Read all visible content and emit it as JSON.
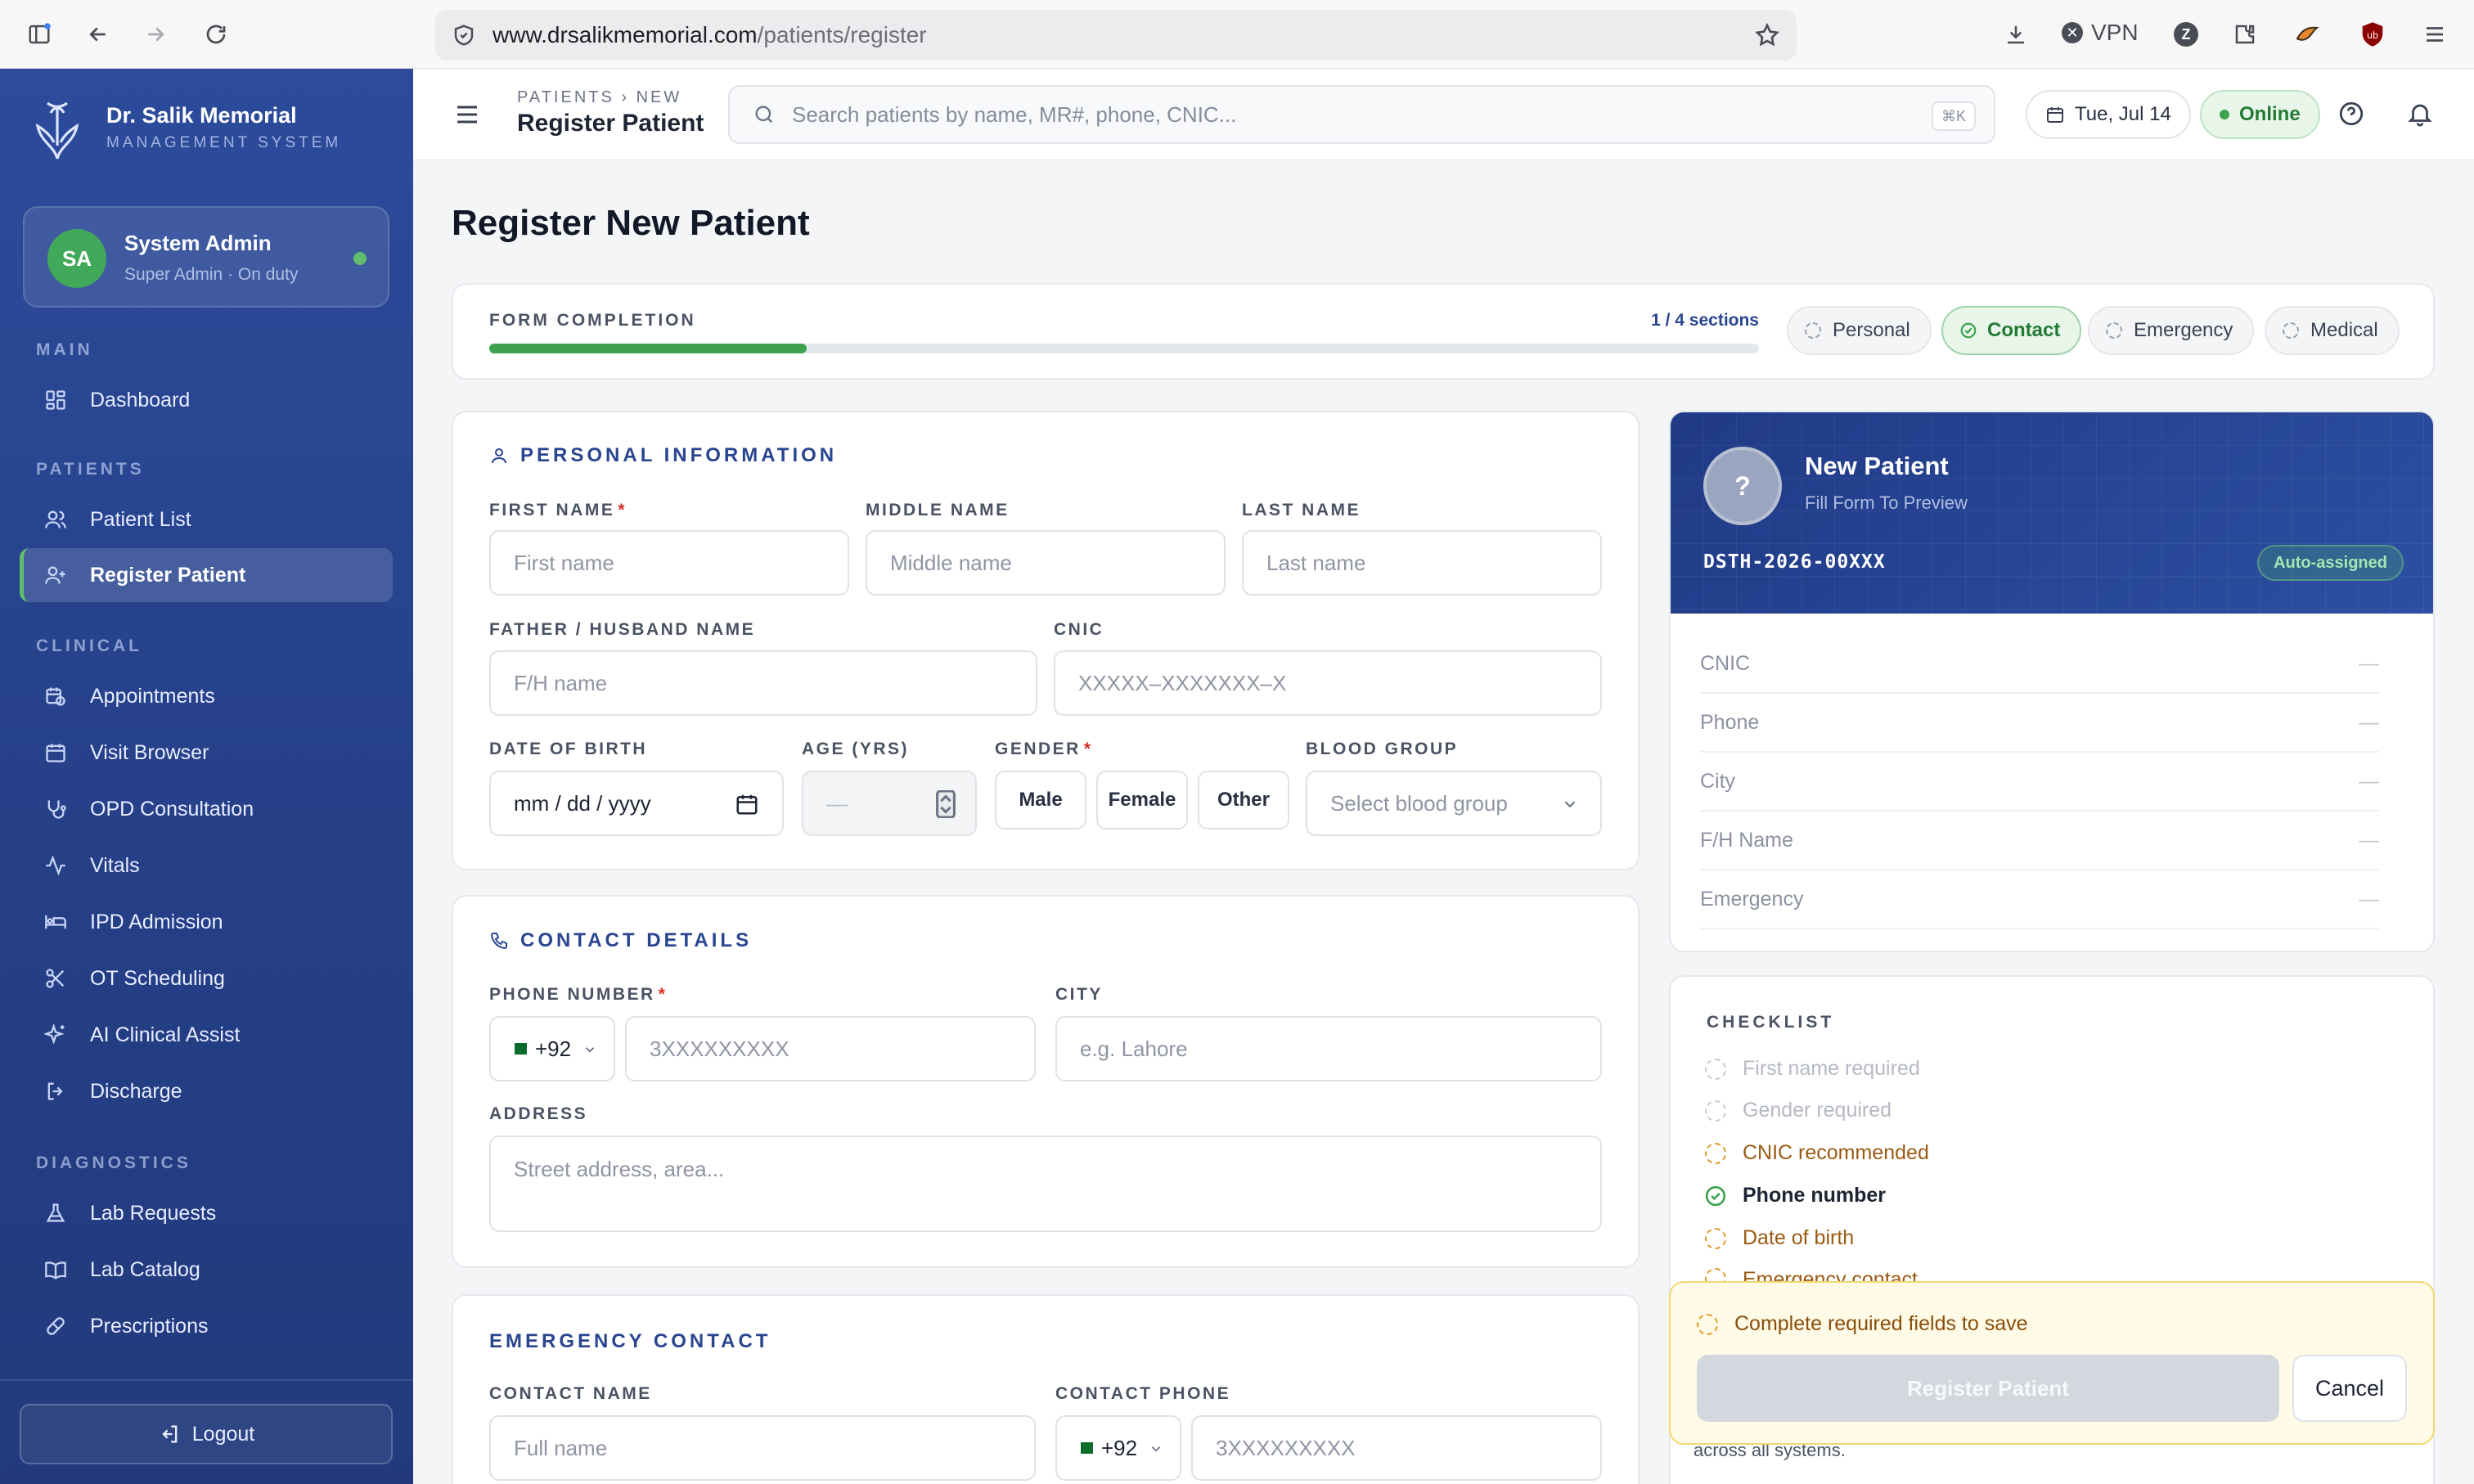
{
  "browser": {
    "url_host": "www.drsalikmemorial.com",
    "url_path": "/patients/register",
    "vpn_label": "VPN",
    "ext_z": "Z",
    "ext_ub": "ub"
  },
  "brand": {
    "name": "Dr. Salik Memorial",
    "subtitle": "MANAGEMENT SYSTEM"
  },
  "user": {
    "initials": "SA",
    "name": "System Admin",
    "role": "Super Admin · On duty"
  },
  "nav": {
    "main_header": "MAIN",
    "main_items": [
      {
        "label": "Dashboard",
        "icon": "dashboard-icon"
      }
    ],
    "patients_header": "PATIENTS",
    "patients_items": [
      {
        "label": "Patient List",
        "icon": "users-icon"
      },
      {
        "label": "Register Patient",
        "icon": "user-plus-icon",
        "active": true
      }
    ],
    "clinical_header": "CLINICAL",
    "clinical_items": [
      {
        "label": "Appointments",
        "icon": "calendar-clock-icon"
      },
      {
        "label": "Visit Browser",
        "icon": "calendar-icon"
      },
      {
        "label": "OPD Consultation",
        "icon": "stethoscope-icon"
      },
      {
        "label": "Vitals",
        "icon": "activity-icon"
      },
      {
        "label": "IPD Admission",
        "icon": "bed-icon"
      },
      {
        "label": "OT Scheduling",
        "icon": "scissors-icon"
      },
      {
        "label": "AI Clinical Assist",
        "icon": "sparkles-icon"
      },
      {
        "label": "Discharge",
        "icon": "log-out-icon"
      }
    ],
    "diagnostics_header": "DIAGNOSTICS",
    "diagnostics_items": [
      {
        "label": "Lab Requests",
        "icon": "flask-icon"
      },
      {
        "label": "Lab Catalog",
        "icon": "book-icon"
      },
      {
        "label": "Prescriptions",
        "icon": "pill-icon"
      }
    ],
    "logout": "Logout"
  },
  "header": {
    "breadcrumb": "PATIENTS › NEW",
    "title": "Register Patient",
    "search_placeholder": "Search patients by name, MR#, phone, CNIC...",
    "search_shortcut": "⌘K",
    "date": "Tue, Jul 14",
    "status": "Online"
  },
  "page": {
    "title": "Register New Patient"
  },
  "progress": {
    "label": "FORM COMPLETION",
    "count": "1 / 4 sections",
    "fraction": 0.25,
    "tabs": [
      {
        "label": "Personal",
        "done": false
      },
      {
        "label": "Contact",
        "done": true
      },
      {
        "label": "Emergency",
        "done": false
      },
      {
        "label": "Medical",
        "done": false
      }
    ]
  },
  "personal": {
    "title": "PERSONAL INFORMATION",
    "first_name_label": "FIRST NAME",
    "first_name_placeholder": "First name",
    "middle_name_label": "MIDDLE NAME",
    "middle_name_placeholder": "Middle name",
    "last_name_label": "LAST NAME",
    "last_name_placeholder": "Last name",
    "fh_label": "FATHER / HUSBAND NAME",
    "fh_placeholder": "F/H name",
    "cnic_label": "CNIC",
    "cnic_placeholder": "XXXXX–XXXXXXX–X",
    "dob_label": "DATE OF BIRTH",
    "dob_placeholder": "mm / dd / yyyy",
    "age_label": "AGE (YRS)",
    "age_placeholder": "—",
    "gender_label": "GENDER",
    "gender_options": [
      "Male",
      "Female",
      "Other"
    ],
    "blood_label": "BLOOD GROUP",
    "blood_placeholder": "Select blood group"
  },
  "contact": {
    "title": "CONTACT DETAILS",
    "phone_label": "PHONE NUMBER",
    "country_code": "+92",
    "phone_placeholder": "3XXXXXXXXX",
    "city_label": "CITY",
    "city_placeholder": "e.g. Lahore",
    "address_label": "ADDRESS",
    "address_placeholder": "Street address, area..."
  },
  "emergency": {
    "title": "EMERGENCY CONTACT",
    "name_label": "CONTACT NAME",
    "name_placeholder": "Full name",
    "phone_label": "CONTACT PHONE",
    "country_code": "+92",
    "phone_placeholder": "3XXXXXXXXX"
  },
  "preview": {
    "avatar": "?",
    "name": "New Patient",
    "hint": "Fill Form To Preview",
    "mr_number": "DSTH-2026-00XXX",
    "badge": "Auto-assigned",
    "rows": [
      {
        "label": "CNIC",
        "value": "—"
      },
      {
        "label": "Phone",
        "value": "—"
      },
      {
        "label": "City",
        "value": "—"
      },
      {
        "label": "F/H Name",
        "value": "—"
      },
      {
        "label": "Emergency",
        "value": "—"
      }
    ]
  },
  "checklist": {
    "title": "CHECKLIST",
    "items": [
      {
        "label": "First name required",
        "state": "pending",
        "color": "#b4b9c2"
      },
      {
        "label": "Gender required",
        "state": "pending",
        "color": "#b4b9c2"
      },
      {
        "label": "CNIC recommended",
        "state": "warn",
        "color": "#9a5a12"
      },
      {
        "label": "Phone number",
        "state": "done",
        "color": "#1d2433"
      },
      {
        "label": "Date of birth",
        "state": "warn",
        "color": "#9a5a12"
      },
      {
        "label": "Emergency contact",
        "state": "warn",
        "color": "#9a5a12"
      }
    ],
    "footnote": "across all systems."
  },
  "savebar": {
    "message": "Complete required fields to save",
    "register_button": "Register Patient",
    "cancel_button": "Cancel"
  },
  "colors": {
    "sidebar": "#2c4b9b",
    "accent_green": "#3da14f",
    "warn": "#e39a2d",
    "header_card": "#213a85"
  }
}
